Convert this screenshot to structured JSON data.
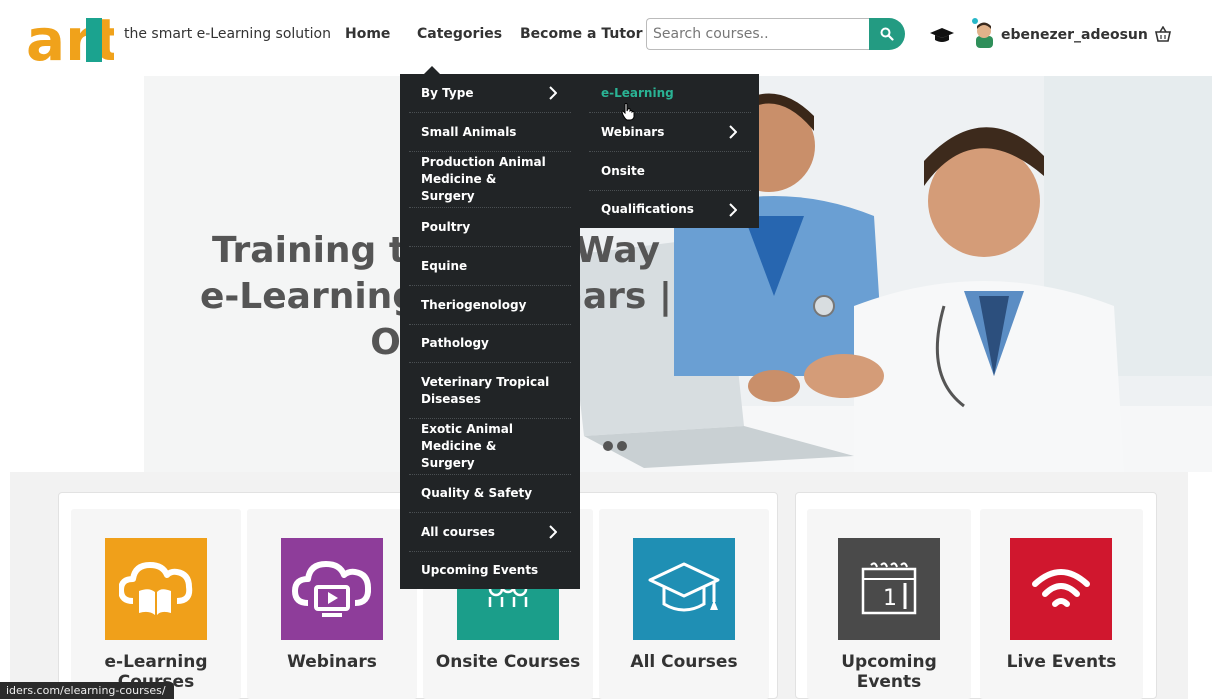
{
  "brand": {
    "logo_text": "art",
    "tagline": "the smart e-Learning solution"
  },
  "nav": {
    "home": "Home",
    "categories": "Categories",
    "tutor": "Become a Tutor"
  },
  "search": {
    "placeholder": "Search courses.."
  },
  "user": {
    "name": "ebenezer_adeosun"
  },
  "hero": {
    "line1": "Training the Easy Way",
    "line2": "e-Learning | Webinars | Onsite"
  },
  "menu": {
    "main": [
      "By Type",
      "Small Animals",
      "Production Animal Medicine & Surgery",
      "Poultry",
      "Equine",
      "Theriogenology",
      "Pathology",
      "Veterinary Tropical Diseases",
      "Exotic Animal Medicine & Surgery",
      "Quality & Safety",
      "All courses",
      "Upcoming Events"
    ],
    "sub": [
      "e-Learning",
      "Webinars",
      "Onsite",
      "Qualifications"
    ]
  },
  "cards": [
    "e-Learning Courses",
    "Webinars",
    "Onsite Courses",
    "All Courses",
    "Upcoming Events",
    "Live Events"
  ],
  "calendar_day": "1",
  "status_url": "iders.com/elearning-courses/",
  "colors": {
    "accent": "#239b82",
    "menu_bg": "#212426",
    "menu_active": "#2ab394",
    "logo_orange": "#f0a21b",
    "logo_teal": "#1ba38f",
    "elearning": "#f0a01a",
    "webinars": "#8e3d9a",
    "onsite": "#1b9e8a",
    "all": "#1f8fb4",
    "upcoming": "#4a4a4a",
    "live": "#d0172e"
  }
}
